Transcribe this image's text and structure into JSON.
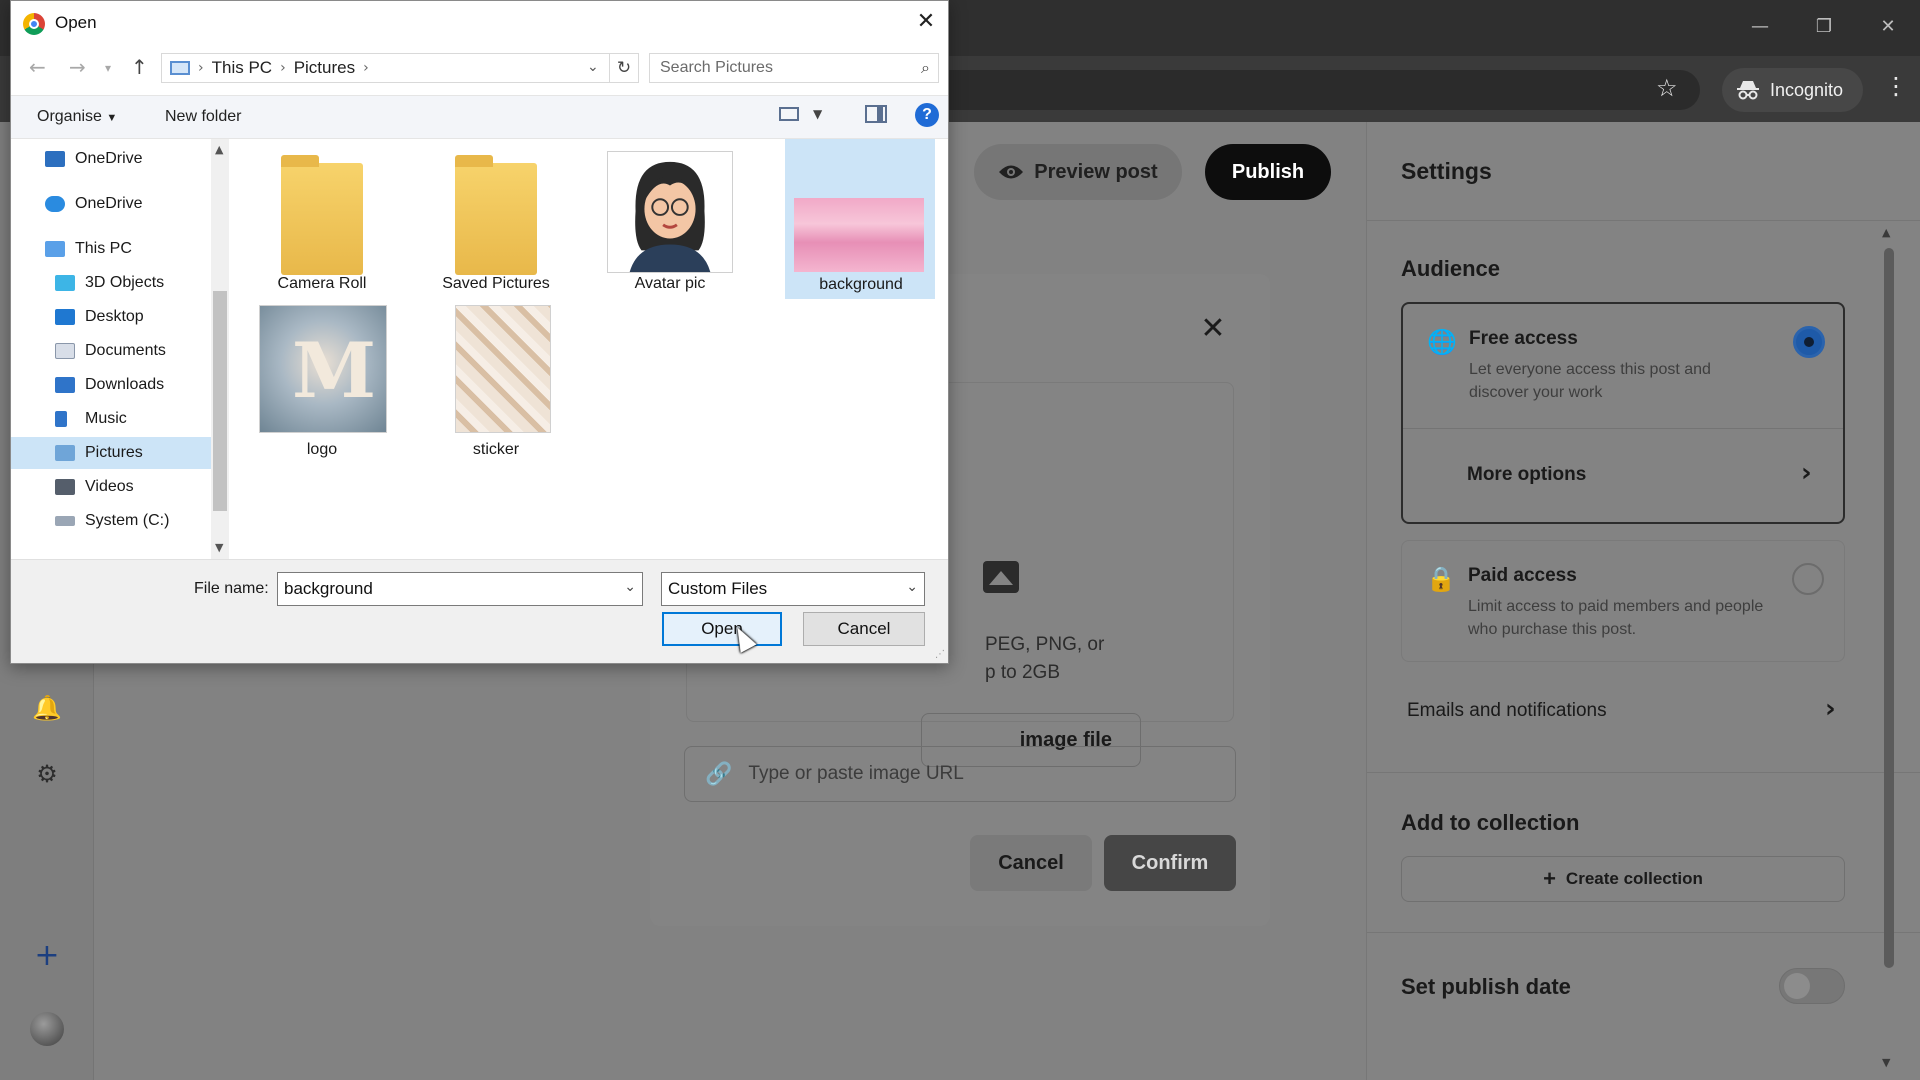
{
  "browser": {
    "incognito_label": "Incognito",
    "star_icon": "star-icon",
    "menu_icon": "kebab-menu-icon"
  },
  "editor": {
    "preview_label": "Preview post",
    "publish_label": "Publish"
  },
  "settings": {
    "title": "Settings",
    "audience_heading": "Audience",
    "free_access": {
      "title": "Free access",
      "description": "Let everyone access this post and discover your work",
      "selected": true
    },
    "more_options_label": "More options",
    "paid_access": {
      "title": "Paid access",
      "description": "Limit access to paid members and people who purchase this post.",
      "selected": false
    },
    "emails_label": "Emails and notifications",
    "collection_heading": "Add to collection",
    "create_collection_label": "Create collection",
    "publish_date_label": "Set publish date",
    "publish_date_enabled": false
  },
  "image_modal": {
    "drop_text_line1": "PEG, PNG, or",
    "drop_text_line2": "p to 2GB",
    "choose_label": "image file",
    "url_placeholder": "Type or paste image URL",
    "cancel_label": "Cancel",
    "confirm_label": "Confirm"
  },
  "file_dialog": {
    "title": "Open",
    "breadcrumb": [
      "This PC",
      "Pictures"
    ],
    "search_placeholder": "Search Pictures",
    "organise_label": "Organise",
    "new_folder_label": "New folder",
    "nav_items": [
      {
        "label": "OneDrive",
        "icon": "onedrive-icon"
      },
      {
        "label": "OneDrive",
        "icon": "cloud-icon"
      },
      {
        "label": "This PC",
        "icon": "computer-icon"
      },
      {
        "label": "3D Objects",
        "icon": "cube-icon"
      },
      {
        "label": "Desktop",
        "icon": "desktop-icon"
      },
      {
        "label": "Documents",
        "icon": "document-icon"
      },
      {
        "label": "Downloads",
        "icon": "download-icon"
      },
      {
        "label": "Music",
        "icon": "music-icon"
      },
      {
        "label": "Pictures",
        "icon": "pictures-icon",
        "selected": true
      },
      {
        "label": "Videos",
        "icon": "video-icon"
      },
      {
        "label": "System (C:)",
        "icon": "drive-icon"
      }
    ],
    "files": [
      {
        "label": "Camera Roll",
        "kind": "folder"
      },
      {
        "label": "Saved Pictures",
        "kind": "folder"
      },
      {
        "label": "Avatar pic",
        "kind": "image"
      },
      {
        "label": "background",
        "kind": "image",
        "selected": true
      },
      {
        "label": "logo",
        "kind": "image"
      },
      {
        "label": "sticker",
        "kind": "image"
      }
    ],
    "file_name_label": "File name:",
    "file_name_value": "background",
    "file_type_value": "Custom Files",
    "open_label": "Open",
    "cancel_label": "Cancel"
  },
  "colors": {
    "accent": "#0078d7",
    "selection": "#cce4f7",
    "radio_selected": "#1e5aa8"
  }
}
